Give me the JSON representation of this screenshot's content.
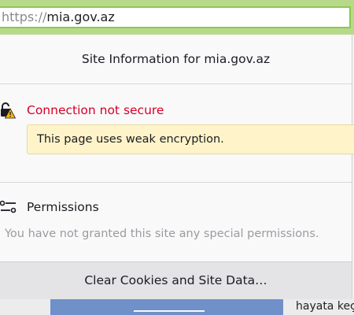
{
  "url_bar": {
    "scheme": "https://",
    "host": "mia.gov.az"
  },
  "panel": {
    "title": "Site Information for mia.gov.az",
    "security": {
      "status_label": "Connection not secure",
      "warning_message": "This page uses weak encryption.",
      "status_color": "#d70022"
    },
    "permissions": {
      "title": "Permissions",
      "description": "You have not granted this site any special permissions."
    },
    "clear_button_label": "Clear Cookies and Site Data…"
  },
  "background_page": {
    "link_text": "_______________",
    "partial_text": "hayata keç"
  }
}
